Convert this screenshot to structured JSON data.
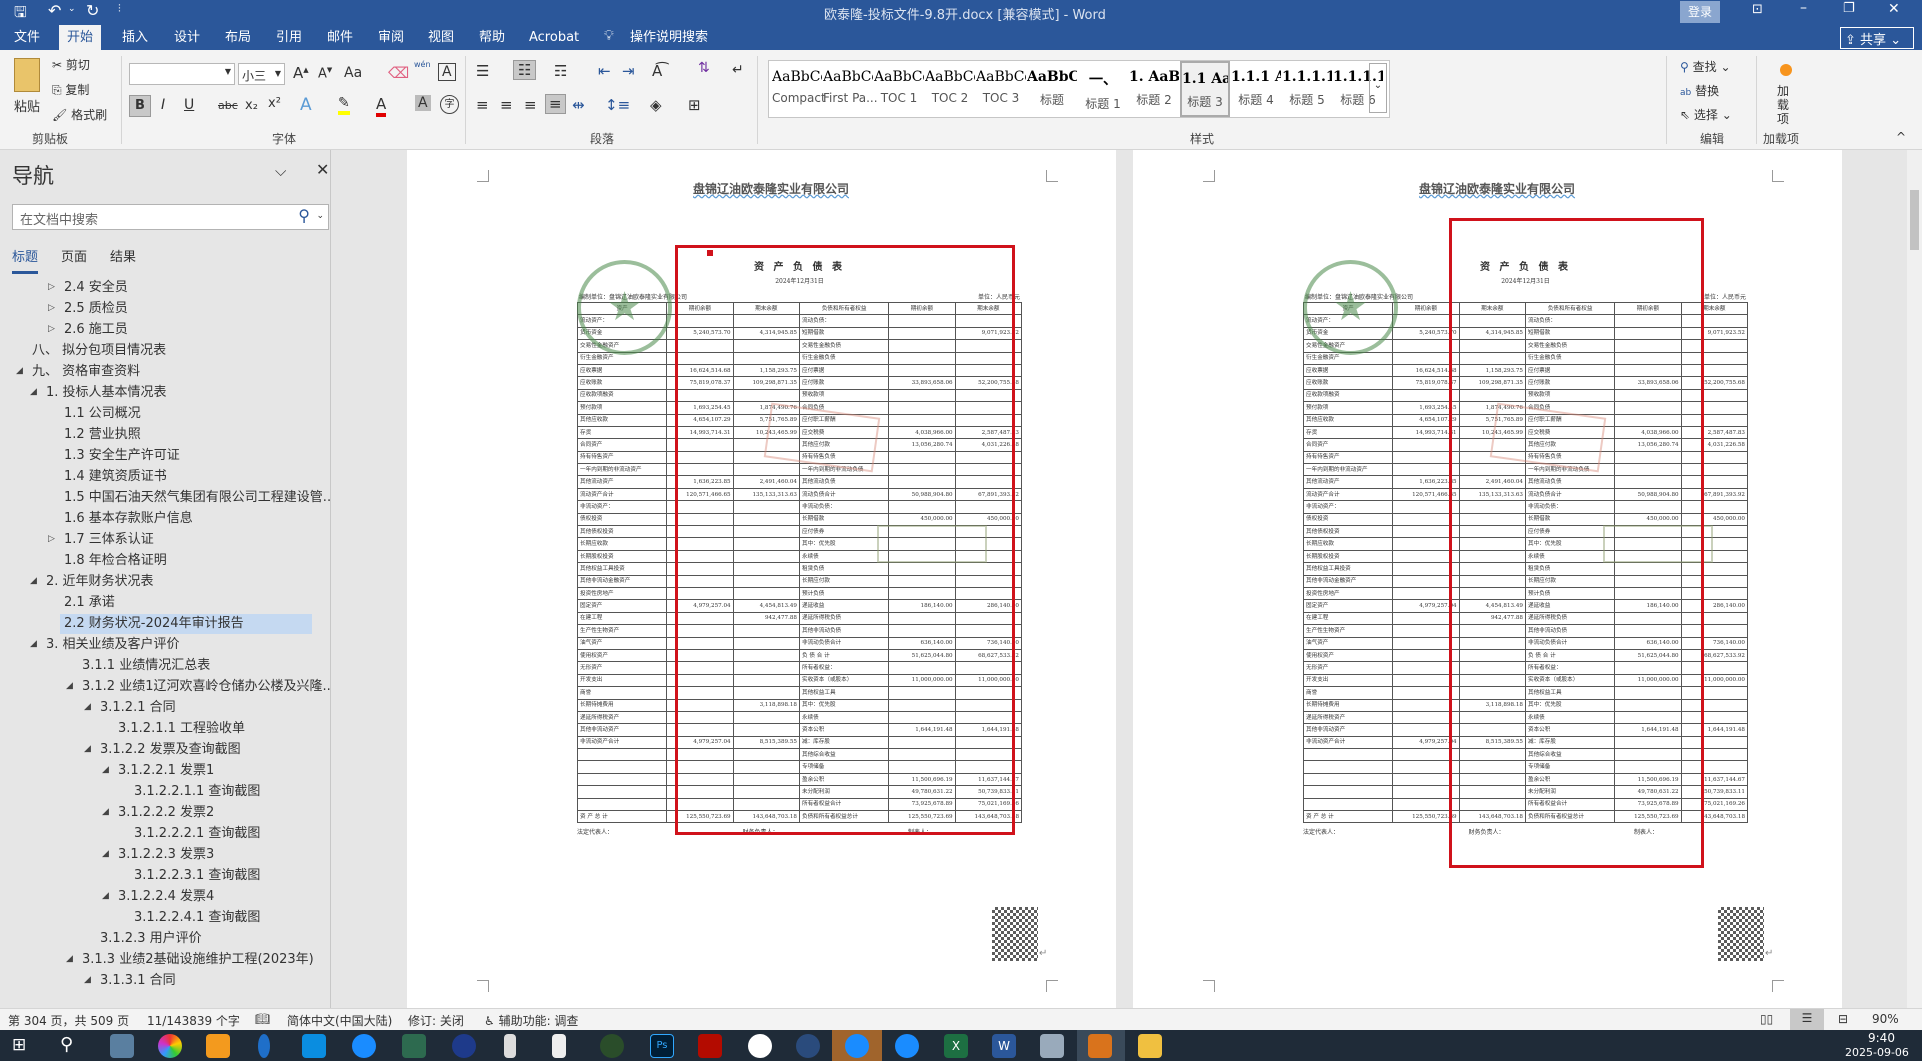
{
  "titlebar": {
    "title": "欧泰隆-投标文件-9.8开.docx [兼容模式]  -  Word",
    "login": "登录",
    "share": "共享"
  },
  "tabs": [
    "文件",
    "开始",
    "插入",
    "设计",
    "布局",
    "引用",
    "邮件",
    "审阅",
    "视图",
    "帮助",
    "Acrobat"
  ],
  "tell_me": "操作说明搜索",
  "ribbon": {
    "clipboard": {
      "paste": "粘贴",
      "cut": "剪切",
      "copy": "复制",
      "format_painter": "格式刷",
      "label": "剪贴板"
    },
    "font": {
      "font_name": "",
      "font_size": "小三",
      "label": "字体",
      "change_case": "Aa",
      "bold": "B",
      "italic": "I",
      "underline": "U",
      "strike": "abc",
      "sub": "x₂",
      "sup": "x²",
      "phonetic": "wén",
      "char_border": "A",
      "char_shading": "A",
      "enclose": "字"
    },
    "paragraph": {
      "label": "段落"
    },
    "styles": {
      "label": "样式",
      "items": [
        {
          "preview": "AaBbCcDd",
          "name": "Compact"
        },
        {
          "preview": "AaBbCcDd",
          "name": "First Pa..."
        },
        {
          "preview": "AaBbCcDd",
          "name": "TOC 1"
        },
        {
          "preview": "AaBbCcDd",
          "name": "TOC 2"
        },
        {
          "preview": "AaBbCcDd",
          "name": "TOC 3"
        },
        {
          "preview": "AaBbC",
          "name": "标题"
        },
        {
          "preview": "一、",
          "name": "标题 1"
        },
        {
          "preview": "1. AaB",
          "name": "标题 2"
        },
        {
          "preview": "1.1 Aa",
          "name": "标题 3"
        },
        {
          "preview": "1.1.1 A",
          "name": "标题 4"
        },
        {
          "preview": "1.1.1.1",
          "name": "标题 5"
        },
        {
          "preview": "1.1.1.1.1",
          "name": "标题 6"
        }
      ]
    },
    "editing": {
      "find": "查找",
      "replace": "替换",
      "select": "选择",
      "label": "编辑"
    },
    "addins": {
      "button": "加载项",
      "label": "加载项"
    }
  },
  "nav": {
    "title": "导航",
    "search_placeholder": "在文档中搜索",
    "tabs": [
      "标题",
      "页面",
      "结果"
    ],
    "items": [
      {
        "label": "2.4 安全员",
        "level": 3,
        "toggle": "collapsed"
      },
      {
        "label": "2.5 质检员",
        "level": 3,
        "toggle": "collapsed"
      },
      {
        "label": "2.6 施工员",
        "level": 3,
        "toggle": "collapsed"
      },
      {
        "label": "八、 拟分包项目情况表",
        "level": 1,
        "toggle": "none"
      },
      {
        "label": "九、 资格审查资料",
        "level": 1,
        "toggle": "expanded"
      },
      {
        "label": "1. 投标人基本情况表",
        "level": 2,
        "toggle": "expanded"
      },
      {
        "label": "1.1 公司概况",
        "level": 3,
        "toggle": "none"
      },
      {
        "label": "1.2 营业执照",
        "level": 3,
        "toggle": "none"
      },
      {
        "label": "1.3 安全生产许可证",
        "level": 3,
        "toggle": "none"
      },
      {
        "label": "1.4 建筑资质证书",
        "level": 3,
        "toggle": "none"
      },
      {
        "label": "1.5 中国石油天然气集团有限公司工程建设管...",
        "level": 3,
        "toggle": "none"
      },
      {
        "label": "1.6 基本存款账户信息",
        "level": 3,
        "toggle": "none"
      },
      {
        "label": "1.7 三体系认证",
        "level": 3,
        "toggle": "collapsed"
      },
      {
        "label": "1.8 年检合格证明",
        "level": 3,
        "toggle": "none"
      },
      {
        "label": "2. 近年财务状况表",
        "level": 2,
        "toggle": "expanded"
      },
      {
        "label": "2.1 承诺",
        "level": 3,
        "toggle": "none"
      },
      {
        "label": "2.2 财务状况-2024年审计报告",
        "level": 3,
        "toggle": "none",
        "selected": true
      },
      {
        "label": "3. 相关业绩及客户评价",
        "level": 2,
        "toggle": "expanded"
      },
      {
        "label": "3.1.1 业绩情况汇总表",
        "level": 4,
        "toggle": "none"
      },
      {
        "label": "3.1.2 业绩1辽河欢喜岭仓储办公楼及兴隆...",
        "level": 4,
        "toggle": "expanded"
      },
      {
        "label": "3.1.2.1 合同",
        "level": 5,
        "toggle": "expanded"
      },
      {
        "label": "3.1.2.1.1 工程验收单",
        "level": 6,
        "toggle": "none"
      },
      {
        "label": "3.1.2.2 发票及查询截图",
        "level": 5,
        "toggle": "expanded"
      },
      {
        "label": "3.1.2.2.1 发票1",
        "level": 6,
        "toggle": "expanded"
      },
      {
        "label": "3.1.2.2.1.1 查询截图",
        "level": 7,
        "toggle": "none"
      },
      {
        "label": "3.1.2.2.2 发票2",
        "level": 6,
        "toggle": "expanded"
      },
      {
        "label": "3.1.2.2.2.1 查询截图",
        "level": 7,
        "toggle": "none"
      },
      {
        "label": "3.1.2.2.3 发票3",
        "level": 6,
        "toggle": "expanded"
      },
      {
        "label": "3.1.2.2.3.1 查询截图",
        "level": 7,
        "toggle": "none"
      },
      {
        "label": "3.1.2.2.4 发票4",
        "level": 6,
        "toggle": "expanded"
      },
      {
        "label": "3.1.2.2.4.1 查询截图",
        "level": 7,
        "toggle": "none"
      },
      {
        "label": "3.1.2.3 用户评价",
        "level": 5,
        "toggle": "none"
      },
      {
        "label": "3.1.3 业绩2基础设施维护工程(2023年)",
        "level": 4,
        "toggle": "expanded"
      },
      {
        "label": "3.1.3.1 合同",
        "level": 5,
        "toggle": "expanded"
      }
    ]
  },
  "document": {
    "header": "盘锦辽油欧泰隆实业有限公司",
    "sheet": {
      "title": "资 产 负 债 表",
      "date": "2024年12月31日",
      "company": "编制单位：盘锦辽油欧泰隆实业有限公司",
      "unit": "单位：人民币元",
      "columns": [
        "资产",
        "期初余额",
        "期末余额",
        "负债和所有者权益",
        "期初余额",
        "期末余额"
      ],
      "rows": [
        [
          "流动资产：",
          "",
          "",
          "流动负债：",
          "",
          ""
        ],
        [
          "货币资金",
          "5,240,573.70",
          "4,314,945.85",
          "短期借款",
          "",
          "9,071,923.52"
        ],
        [
          "交易性金融资产",
          "",
          "",
          "交易性金融负债",
          "",
          ""
        ],
        [
          "衍生金融资产",
          "",
          "",
          "衍生金融负债",
          "",
          ""
        ],
        [
          "应收票据",
          "16,624,514.68",
          "1,158,293.75",
          "应付票据",
          "",
          ""
        ],
        [
          "应收账款",
          "75,819,078.37",
          "109,298,871.35",
          "应付账款",
          "33,893,658.06",
          "52,200,755.68"
        ],
        [
          "应收款项融资",
          "",
          "",
          "预收款项",
          "",
          ""
        ],
        [
          "预付款项",
          "1,693,254.45",
          "1,874,490.76",
          "合同负债",
          "",
          ""
        ],
        [
          "其他应收款",
          "4,654,107.29",
          "5,751,765.89",
          "应付职工薪酬",
          "",
          ""
        ],
        [
          "存货",
          "14,993,714.31",
          "10,243,465.99",
          "应交税费",
          "4,038,966.00",
          "2,587,487.83"
        ],
        [
          "合同资产",
          "",
          "",
          "其他应付款",
          "13,056,280.74",
          "4,031,226.58"
        ],
        [
          "持有待售资产",
          "",
          "",
          "持有待售负债",
          "",
          ""
        ],
        [
          "一年内到期的非流动资产",
          "",
          "",
          "一年内到期的非流动负债",
          "",
          ""
        ],
        [
          "其他流动资产",
          "1,636,223.85",
          "2,491,460.04",
          "其他流动负债",
          "",
          ""
        ],
        [
          "流动资产合计",
          "120,571,466.65",
          "135,133,313.63",
          "流动负债合计",
          "50,988,904.80",
          "67,891,393.92"
        ],
        [
          "非流动资产：",
          "",
          "",
          "非流动负债：",
          "",
          ""
        ],
        [
          "债权投资",
          "",
          "",
          "长期借款",
          "450,000.00",
          "450,000.00"
        ],
        [
          "其他债权投资",
          "",
          "",
          "应付债券",
          "",
          ""
        ],
        [
          "长期应收款",
          "",
          "",
          "其中：优先股",
          "",
          ""
        ],
        [
          "长期股权投资",
          "",
          "",
          "永续债",
          "",
          ""
        ],
        [
          "其他权益工具投资",
          "",
          "",
          "租赁负债",
          "",
          ""
        ],
        [
          "其他非流动金融资产",
          "",
          "",
          "长期应付款",
          "",
          ""
        ],
        [
          "投资性房地产",
          "",
          "",
          "预计负债",
          "",
          ""
        ],
        [
          "固定资产",
          "4,979,257.04",
          "4,454,813.49",
          "递延收益",
          "186,140.00",
          "286,140.00"
        ],
        [
          "在建工程",
          "",
          "942,477.88",
          "递延所得税负债",
          "",
          ""
        ],
        [
          "生产性生物资产",
          "",
          "",
          "其他非流动负债",
          "",
          ""
        ],
        [
          "油气资产",
          "",
          "",
          "非流动负债合计",
          "636,140.00",
          "736,140.00"
        ],
        [
          "使用权资产",
          "",
          "",
          "负 债 合 计",
          "51,625,044.80",
          "68,627,533.92"
        ],
        [
          "无形资产",
          "",
          "",
          "所有者权益：",
          "",
          ""
        ],
        [
          "开发支出",
          "",
          "",
          "实收资本（或股本）",
          "11,000,000.00",
          "11,000,000.00"
        ],
        [
          "商誉",
          "",
          "",
          "其他权益工具",
          "",
          ""
        ],
        [
          "长期待摊费用",
          "",
          "3,118,898.18",
          "其中：优先股",
          "",
          ""
        ],
        [
          "递延所得税资产",
          "",
          "",
          "永续债",
          "",
          ""
        ],
        [
          "其他非流动资产",
          "",
          "",
          "资本公积",
          "1,644,191.48",
          "1,644,191.48"
        ],
        [
          "非流动资产合计",
          "4,979,257.04",
          "8,515,389.55",
          "减：库存股",
          "",
          ""
        ],
        [
          "",
          "",
          "",
          "其他综合收益",
          "",
          ""
        ],
        [
          "",
          "",
          "",
          "专项储备",
          "",
          ""
        ],
        [
          "",
          "",
          "",
          "盈余公积",
          "11,500,696.19",
          "11,637,144.67"
        ],
        [
          "",
          "",
          "",
          "未分配利润",
          "49,780,631.22",
          "50,739,833.11"
        ],
        [
          "",
          "",
          "",
          "所有者权益合计",
          "73,925,678.89",
          "75,021,169.26"
        ],
        [
          "资 产 总 计",
          "125,550,723.69",
          "143,648,703.18",
          "负债和所有者权益总计",
          "125,550,723.69",
          "143,648,703.18"
        ]
      ],
      "signatures": [
        "法定代表人：",
        "财务负责人：",
        "制表人："
      ]
    }
  },
  "status": {
    "page": "第 304 页，共 509 页",
    "words": "11/143839 个字",
    "language": "简体中文(中国大陆)",
    "track": "修订: 关闭",
    "accessibility": "辅助功能: 调查",
    "zoom": "90%"
  },
  "taskbar": {
    "time": "9:40",
    "date": "2025-09-06"
  },
  "colors": {
    "brand": "#2b579a",
    "annotation": "#d0121b",
    "stamp_green": "#4a8a4a",
    "stamp_red": "#d88a7a"
  }
}
